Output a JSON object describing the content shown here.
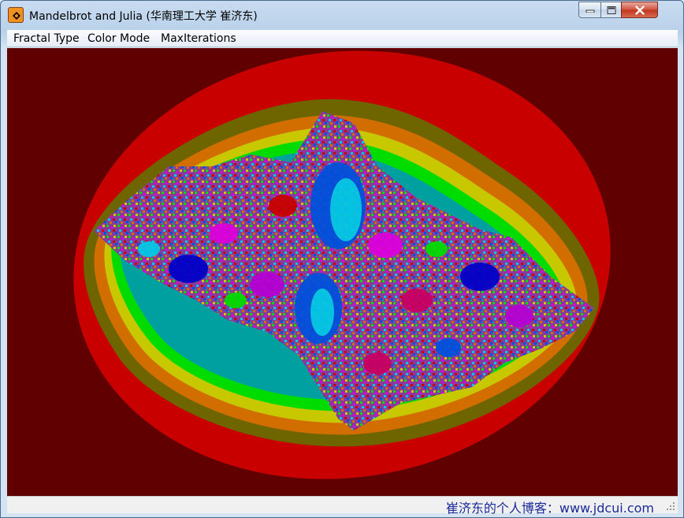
{
  "window": {
    "title": "Mandelbrot and Julia (华南理工大学 崔济东)"
  },
  "menu": {
    "items": [
      "Fractal Type",
      "Color Mode",
      "MaxIterations"
    ]
  },
  "canvas": {
    "background_color": "#600000",
    "fractal_type": "julia-set",
    "band_colors": [
      "#c80000",
      "#6e6400",
      "#d26e00",
      "#c8c800",
      "#00b400",
      "#00dc00",
      "#00a0a0",
      "#00c8e6",
      "#0050dc",
      "#0000c8",
      "#b400d2",
      "#dc00dc",
      "#c80064"
    ]
  },
  "status": {
    "text": "崔济东的个人博客：www.jdcui.com"
  }
}
